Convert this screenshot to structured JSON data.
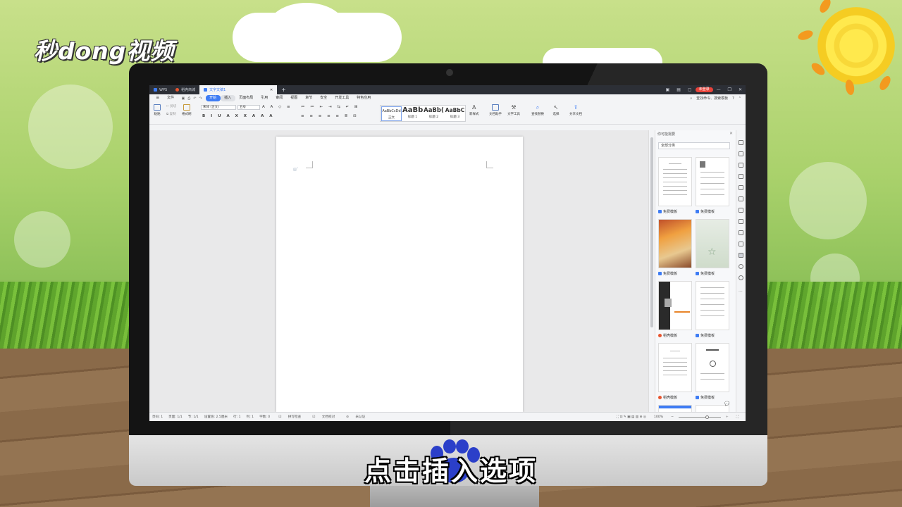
{
  "brand_logo": "秒dong视频",
  "subtitle": "点击插入选项",
  "colors": {
    "accent": "#3e7cf4",
    "login": "#e8433a",
    "titlebar": "#2c2f36"
  },
  "tabs": [
    {
      "label": "WPS",
      "icon": "wps-icon"
    },
    {
      "label": "稻壳商城",
      "icon": "docer-icon"
    },
    {
      "label": "文字文稿1",
      "icon": "doc-icon"
    }
  ],
  "titlebar": {
    "login": "未登录"
  },
  "menu": {
    "file": "文件",
    "items": [
      "开始",
      "插入",
      "页面布局",
      "引用",
      "审阅",
      "视图",
      "章节",
      "安全",
      "开发工具",
      "特色应用"
    ],
    "search": "查找命令、搜索模板"
  },
  "ribbon": {
    "paste": "粘贴",
    "cut": "剪切",
    "copy": "复制",
    "format_painter": "格式刷",
    "font_name": "宋体 (正文)",
    "font_size": "五号",
    "styles": [
      {
        "preview": "AaBbCcDd",
        "caption": "正文"
      },
      {
        "preview": "AaBb",
        "caption": "标题 1"
      },
      {
        "preview": "AaBb(",
        "caption": "标题 2"
      },
      {
        "preview": "AaBbC",
        "caption": "标题 3"
      }
    ],
    "new_style": "新样式",
    "doc_assistant": "文档助手",
    "text_tools": "文字工具",
    "find_replace": "查找替换",
    "select": "选择",
    "share": "分享文档"
  },
  "panel": {
    "title": "你可能需要",
    "category": "全部分类",
    "templates": [
      {
        "label": "免费模板",
        "badge": "free"
      },
      {
        "label": "免费模板",
        "badge": "free"
      },
      {
        "label": "免费模板",
        "badge": "free"
      },
      {
        "label": "免费模板",
        "badge": "free"
      },
      {
        "label": "稻壳模板",
        "badge": "docer"
      },
      {
        "label": "免费模板",
        "badge": "free"
      },
      {
        "label": "稻壳模板",
        "badge": "docer"
      },
      {
        "label": "免费模板",
        "badge": "free"
      }
    ]
  },
  "status": {
    "page": "页码: 1",
    "pages": "页面: 1/1",
    "section": "节: 1/1",
    "position": "设置值: 2.5厘米",
    "row": "行: 1",
    "col": "列: 1",
    "chars": "字数: 0",
    "spell": "拼写检查",
    "proof": "文档校对",
    "cert": "未认证",
    "zoom": "100%"
  }
}
